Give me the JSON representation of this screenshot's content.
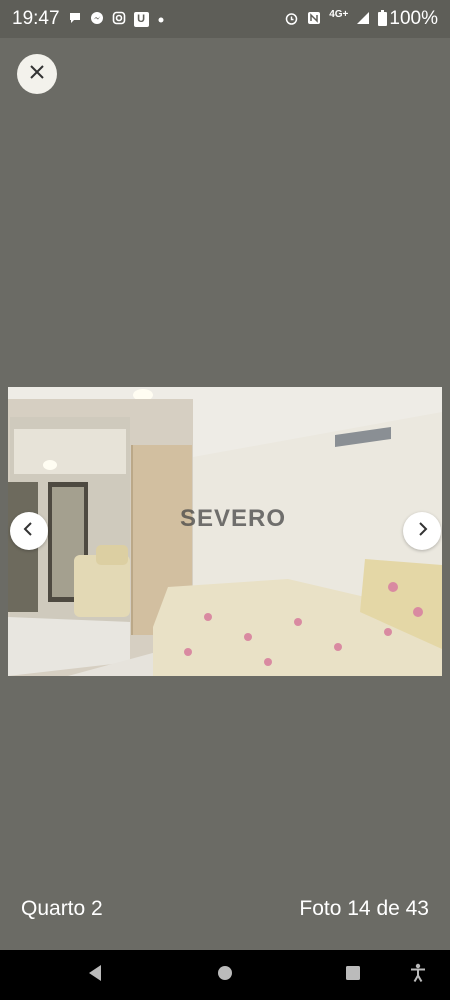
{
  "status_bar": {
    "time": "19:47",
    "left_icons": [
      "chat-bubble-icon",
      "messenger-icon",
      "instagram-icon",
      "u-app-icon",
      "dot-icon"
    ],
    "u_badge": "U",
    "right_icons": [
      "alarm-icon",
      "nfc-icon",
      "signal-icon",
      "battery-icon"
    ],
    "network": "4G+",
    "battery": "100%"
  },
  "photo": {
    "watermark": "SEVERO"
  },
  "caption": {
    "room": "Quarto 2",
    "counter": "Foto 14 de 43"
  },
  "nav_bar": {
    "icons": [
      "back-triangle-icon",
      "home-circle-icon",
      "recents-square-icon",
      "accessibility-icon"
    ]
  },
  "colors": {
    "background": "#6b6b65",
    "status_bar": "#5e5e58",
    "button": "#ffffff"
  }
}
